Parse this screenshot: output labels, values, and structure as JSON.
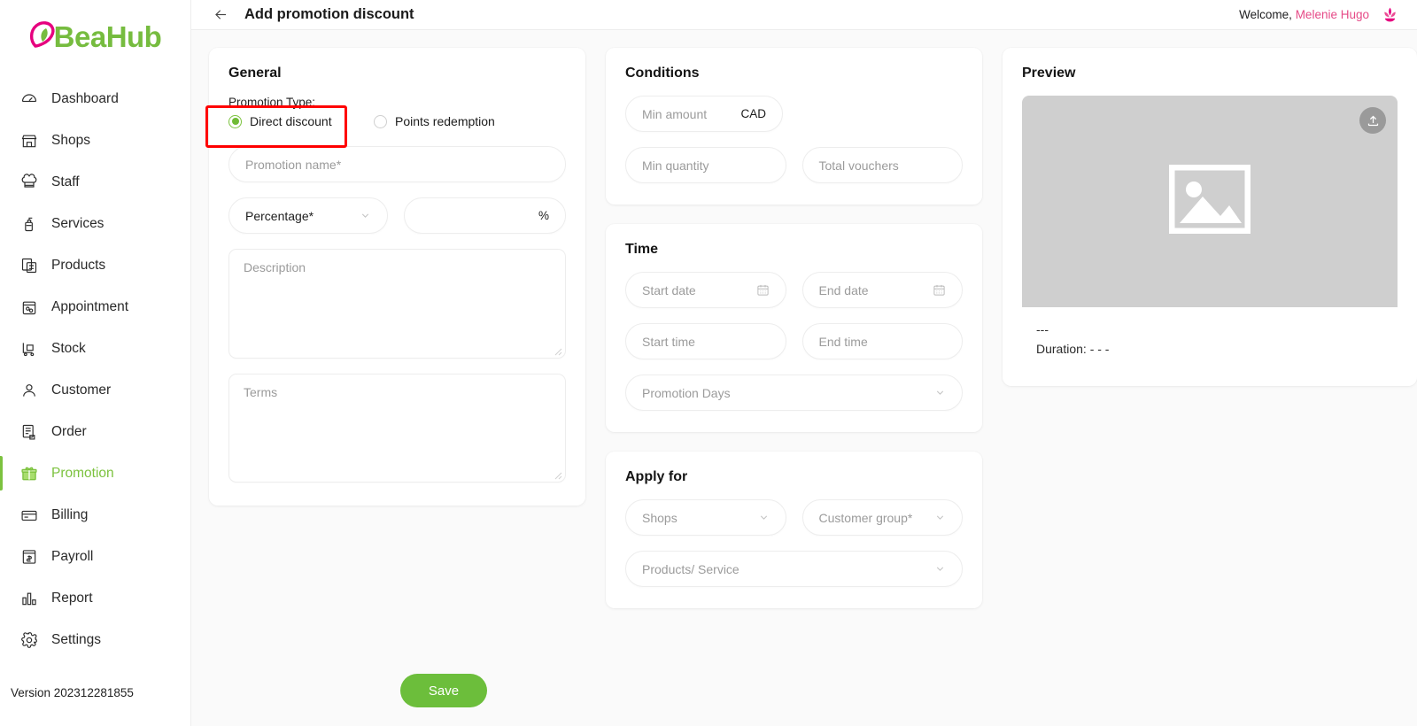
{
  "brand": {
    "logo_text": "BeaHub",
    "logo_mark_color": "#e6007e",
    "logo_text_color": "#76bc3f"
  },
  "sidebar": {
    "items": [
      {
        "label": "Dashboard",
        "icon": "dashboard-icon",
        "active": false
      },
      {
        "label": "Shops",
        "icon": "shop-icon",
        "active": false
      },
      {
        "label": "Staff",
        "icon": "staff-icon",
        "active": false
      },
      {
        "label": "Services",
        "icon": "services-icon",
        "active": false
      },
      {
        "label": "Products",
        "icon": "products-icon",
        "active": false
      },
      {
        "label": "Appointment",
        "icon": "appointment-icon",
        "active": false
      },
      {
        "label": "Stock",
        "icon": "stock-icon",
        "active": false
      },
      {
        "label": "Customer",
        "icon": "customer-icon",
        "active": false
      },
      {
        "label": "Order",
        "icon": "order-icon",
        "active": false
      },
      {
        "label": "Promotion",
        "icon": "gift-icon",
        "active": true
      },
      {
        "label": "Billing",
        "icon": "billing-icon",
        "active": false
      },
      {
        "label": "Payroll",
        "icon": "payroll-icon",
        "active": false
      },
      {
        "label": "Report",
        "icon": "report-icon",
        "active": false
      },
      {
        "label": "Settings",
        "icon": "gear-icon",
        "active": false
      }
    ],
    "version": "Version 202312281855",
    "active_color": "#7cc23f"
  },
  "topbar": {
    "back_icon": "arrow-left-icon",
    "title": "Add promotion discount",
    "welcome_prefix": "Welcome,",
    "user_name": "Melenie Hugo",
    "user_name_color": "#e64a87",
    "avatar_icon": "lotus-flower-icon"
  },
  "general": {
    "title": "General",
    "promotion_type_label": "Promotion Type:",
    "options": [
      {
        "label": "Direct discount",
        "selected": true
      },
      {
        "label": "Points redemption",
        "selected": false
      }
    ],
    "promotion_name_placeholder": "Promotion name*",
    "discount_type_value": "Percentage*",
    "discount_value": "",
    "discount_unit": "%",
    "description_placeholder": "Description",
    "terms_placeholder": "Terms"
  },
  "conditions": {
    "title": "Conditions",
    "min_amount_placeholder": "Min amount",
    "currency": "CAD",
    "min_quantity_placeholder": "Min quantity",
    "total_vouchers_placeholder": "Total vouchers"
  },
  "time": {
    "title": "Time",
    "start_date_placeholder": "Start date",
    "end_date_placeholder": "End date",
    "start_time_placeholder": "Start time",
    "end_time_placeholder": "End time",
    "promotion_days_placeholder": "Promotion Days"
  },
  "apply_for": {
    "title": "Apply for",
    "shops_placeholder": "Shops",
    "customer_group_placeholder": "Customer group*",
    "products_service_placeholder": "Products/ Service"
  },
  "preview": {
    "title": "Preview",
    "upload_icon": "upload-icon",
    "image_placeholder_icon": "image-placeholder-icon",
    "name_value": "---",
    "duration_value": "Duration: - - -"
  },
  "actions": {
    "save_label": "Save",
    "save_color": "#6cbe3b"
  },
  "annotation": {
    "color": "#ff0000",
    "target": "direct-discount-radio"
  }
}
